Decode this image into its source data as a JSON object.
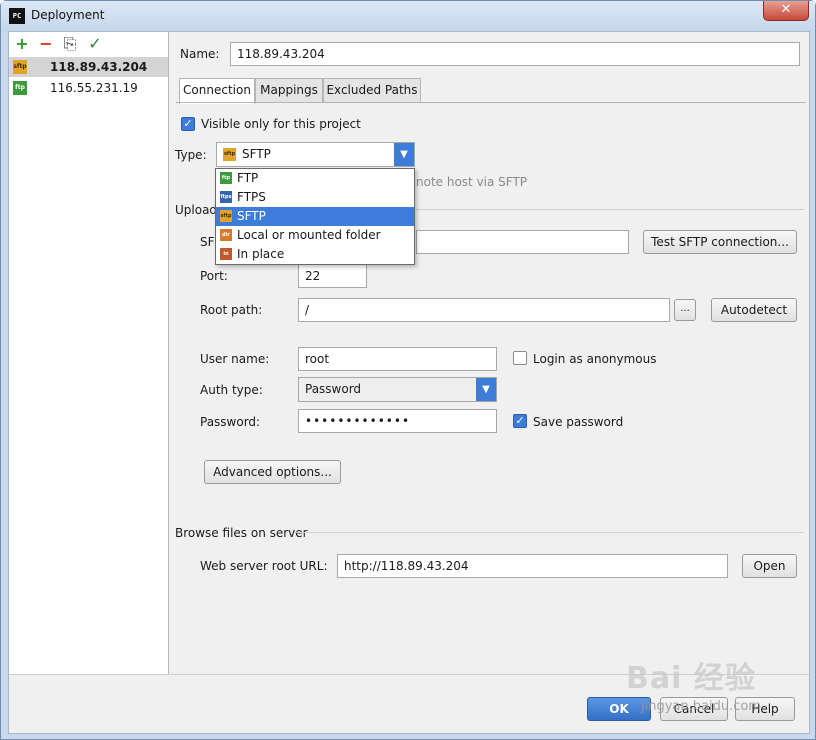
{
  "window": {
    "title": "Deployment",
    "icon_text": "PC",
    "close_glyph": "✕"
  },
  "toolbar": {
    "add": "+",
    "remove": "−",
    "copy": "⎘",
    "set_default": "✓"
  },
  "servers": [
    {
      "name": "118.89.43.204",
      "type": "SFTP",
      "icon_text": "sftp",
      "selected": true
    },
    {
      "name": "116.55.231.19",
      "type": "FTP",
      "icon_text": "ftp",
      "selected": false
    }
  ],
  "form": {
    "name_label": "Name:",
    "name_value": "118.89.43.204",
    "tabs": [
      "Connection",
      "Mappings",
      "Excluded Paths"
    ],
    "active_tab": "Connection",
    "visible_only_label": "Visible only for this project",
    "visible_only_checked": true,
    "type_label": "Type:",
    "type_value": "SFTP",
    "type_icon_text": "sftp",
    "type_hint": "note host via SFTP",
    "upload_section_label": "Upload/",
    "sftp_host_label": "SF",
    "sftp_host_value": "",
    "test_button": "Test SFTP connection...",
    "port_label": "Port:",
    "port_value": "22",
    "root_path_label": "Root path:",
    "root_path_value": "/",
    "browse_button": "...",
    "autodetect_button": "Autodetect",
    "user_name_label": "User name:",
    "user_name_value": "root",
    "anonymous_label": "Login as anonymous",
    "anonymous_checked": false,
    "auth_type_label": "Auth type:",
    "auth_type_value": "Password",
    "password_label": "Password:",
    "password_value": "•••••••••••••",
    "save_password_label": "Save password",
    "save_password_checked": true,
    "advanced_button": "Advanced options...",
    "browse_section_label": "Browse files on server",
    "web_root_label": "Web server root URL:",
    "web_root_value": "http://118.89.43.204",
    "open_button": "Open"
  },
  "type_dropdown": {
    "options": [
      {
        "label": "FTP",
        "icon_text": "ftp",
        "selected": false
      },
      {
        "label": "FTPS",
        "icon_text": "ftps",
        "selected": false
      },
      {
        "label": "SFTP",
        "icon_text": "sftp",
        "selected": true
      },
      {
        "label": "Local or mounted folder",
        "icon_text": "dir",
        "selected": false
      },
      {
        "label": "In place",
        "icon_text": "in",
        "selected": false
      }
    ]
  },
  "footer": {
    "ok": "OK",
    "cancel": "Cancel",
    "help": "Help"
  },
  "watermark": {
    "main": "Bai 经验",
    "sub": "jingyan.baidu.com"
  },
  "colors": {
    "accent": "#3d7cd8",
    "selected_row": "#d4d4d4",
    "add_green": "#2f9a2f",
    "remove_red": "#d03a2a"
  }
}
